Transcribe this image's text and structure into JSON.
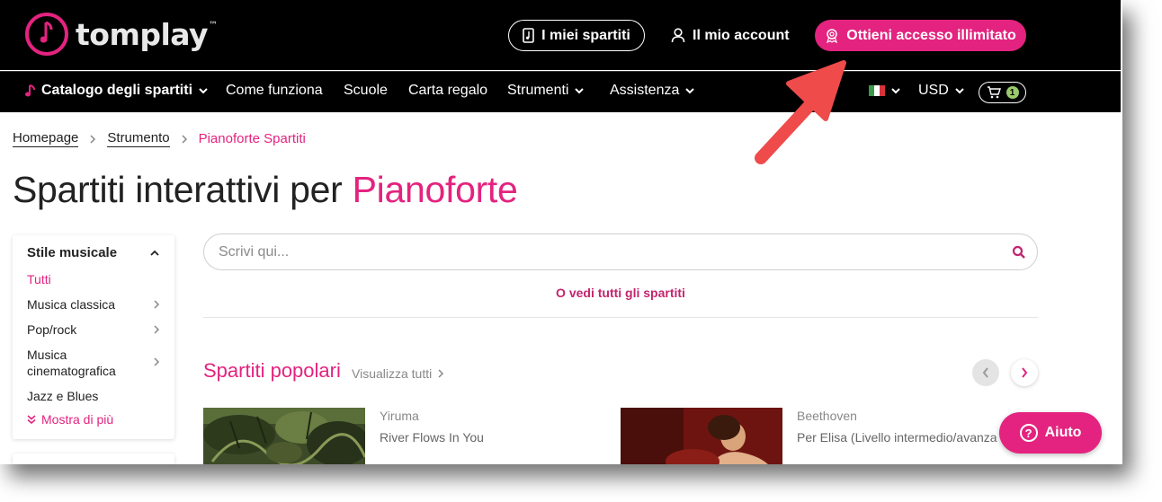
{
  "brand": {
    "name": "tomplay",
    "tm": "™",
    "accent": "#e3237f"
  },
  "header": {
    "my_scores": "I miei spartiti",
    "my_account": "Il mio account",
    "unlimited": "Ottieni accesso illimitato"
  },
  "nav": {
    "catalog": "Catalogo degli spartiti",
    "how": "Come funziona",
    "schools": "Scuole",
    "gift": "Carta regalo",
    "instruments": "Strumenti",
    "support": "Assistenza",
    "currency": "USD",
    "cart_count": "1"
  },
  "breadcrumb": {
    "home": "Homepage",
    "instrument": "Strumento",
    "current": "Pianoforte Spartiti"
  },
  "title": {
    "main": "Spartiti interattivi per ",
    "accent": "Pianoforte"
  },
  "sidebar": {
    "heading": "Stile musicale",
    "items": [
      {
        "label": "Tutti"
      },
      {
        "label": "Musica classica"
      },
      {
        "label": "Pop/rock"
      },
      {
        "label": "Musica cinematografica"
      },
      {
        "label": "Jazz e Blues"
      }
    ],
    "show_more": "Mostra di più"
  },
  "search": {
    "placeholder": "Scrivi qui..."
  },
  "see_all": "O vedi tutti gli spartiti",
  "popular": {
    "title": "Spartiti popolari",
    "view_all": "Visualizza tutti",
    "cards": [
      {
        "composer": "Yiruma",
        "title": "River Flows In You"
      },
      {
        "composer": "Beethoven",
        "title": "Per Elisa (Livello intermedio/avanza"
      }
    ]
  },
  "help": {
    "label": "Aiuto",
    "glyph": "?"
  }
}
